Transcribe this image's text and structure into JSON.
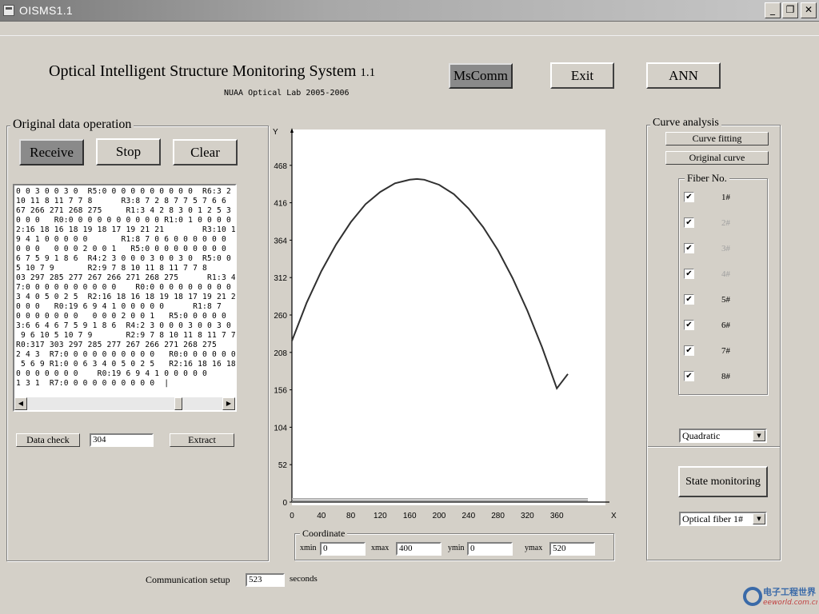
{
  "window": {
    "title": "OISMS1.1",
    "minimize": "_",
    "restore": "❐",
    "close": "✕"
  },
  "header": {
    "title": "Optical Intelligent Structure Monitoring System",
    "version": "1.1",
    "subtitle": "NUAA Optical Lab 2005-2006",
    "mscomm_label": "MsComm",
    "exit_label": "Exit",
    "ann_label": "ANN"
  },
  "original_data": {
    "group_label": "Original data operation",
    "receive_label": "Receive",
    "stop_label": "Stop",
    "clear_label": "Clear",
    "text": "0 0 3 0 0 3 0  R5:0 0 0 0 0 0 0 0 0 0  R6:3 2\n10 11 8 11 7 7 8      R3:8 7 2 8 7 7 5 7 6 6\n67 266 271 268 275     R1:3 4 2 8 3 0 1 2 5 3\n0 0 0   R0:0 0 0 0 0 0 0 0 0 0 R1:0 1 0 0 0 0\n2:16 18 16 18 19 18 17 19 21 21        R3:10 1\n9 4 1 0 0 0 0 0       R1:8 7 0 6 0 0 0 0 0 0\n0 0 0   0 0 0 2 0 0 1   R5:0 0 0 0 0 0 0 0 0\n6 7 5 9 1 8 6  R4:2 3 0 0 0 3 0 0 3 0  R5:0 0\n5 10 7 9       R2:9 7 8 10 11 8 11 7 7 8\n03 297 285 277 267 266 271 268 275      R1:3 4\n7:0 0 0 0 0 0 0 0 0 0    R0:0 0 0 0 0 0 0 0 0 0\n3 4 0 5 0 2 5  R2:16 18 16 18 19 18 17 19 21 2\n0 0 0   R0:19 6 9 4 1 0 0 0 0 0      R1:8 7\n0 0 0 0 0 0 0   0 0 0 2 0 0 1   R5:0 0 0 0 0\n3:6 6 4 6 7 5 9 1 8 6  R4:2 3 0 0 0 3 0 0 3 0\n 9 6 10 5 10 7 9       R2:9 7 8 10 11 8 11 7 7\nR0:317 303 297 285 277 267 266 271 268 275\n2 4 3  R7:0 0 0 0 0 0 0 0 0 0   R0:0 0 0 0 0 0\n 5 6 9 R1:0 0 6 3 4 0 5 0 2 5   R2:16 18 16 18\n0 0 0 0 0 0 0    R0:19 6 9 4 1 0 0 0 0 0\n1 3 1  R7:0 0 0 0 0 0 0 0 0 0  |",
    "data_check_label": "Data check",
    "data_check_value": "304",
    "extract_label": "Extract"
  },
  "communication": {
    "label": "Communication setup",
    "value": "523",
    "unit": "seconds"
  },
  "chart_data": {
    "type": "line",
    "ylabel": "Y",
    "xlabel": "X",
    "xlim": [
      0,
      400
    ],
    "ylim": [
      0,
      520
    ],
    "x_ticks": [
      0,
      40,
      80,
      120,
      160,
      200,
      240,
      280,
      320,
      360
    ],
    "y_ticks": [
      0,
      52,
      104,
      156,
      208,
      260,
      312,
      364,
      416,
      468
    ],
    "series": [
      {
        "color": "#303030",
        "x": [
          0,
          20,
          40,
          60,
          80,
          100,
          120,
          140,
          160,
          170,
          180,
          200,
          220,
          240,
          260,
          280,
          300,
          320,
          340,
          360,
          375
        ],
        "values": [
          224,
          277,
          321,
          358,
          389,
          414,
          431,
          443,
          448,
          449,
          448,
          441,
          428,
          408,
          382,
          350,
          311,
          266,
          215,
          158,
          178
        ]
      }
    ]
  },
  "coordinate": {
    "group_label": "Coordinate",
    "xmin_label": "xmin",
    "xmin_value": "0",
    "xmax_label": "xmax",
    "xmax_value": "400",
    "ymin_label": "ymin",
    "ymin_value": "0",
    "ymax_label": "ymax",
    "ymax_value": "520"
  },
  "curve_analysis": {
    "group_label": "Curve analysis",
    "curve_fitting_label": "Curve fitting",
    "original_curve_label": "Original curve",
    "fiber_group_label": "Fiber No.",
    "fibers": [
      {
        "label": "1#",
        "checked": "✔",
        "enabled": true
      },
      {
        "label": "2#",
        "checked": "✔",
        "enabled": false
      },
      {
        "label": "3#",
        "checked": "✔",
        "enabled": false
      },
      {
        "label": "4#",
        "checked": "✔",
        "enabled": false
      },
      {
        "label": "5#",
        "checked": "✔",
        "enabled": true
      },
      {
        "label": "6#",
        "checked": "✔",
        "enabled": true
      },
      {
        "label": "7#",
        "checked": "✔",
        "enabled": true
      },
      {
        "label": "8#",
        "checked": "✔",
        "enabled": true
      }
    ],
    "fit_type": "Quadratic",
    "state_monitoring_label": "State monitoring",
    "fiber_select": "Optical fiber 1#"
  },
  "watermark": {
    "brand": "电子工程世界",
    "site": "eeworld.com.cn"
  }
}
